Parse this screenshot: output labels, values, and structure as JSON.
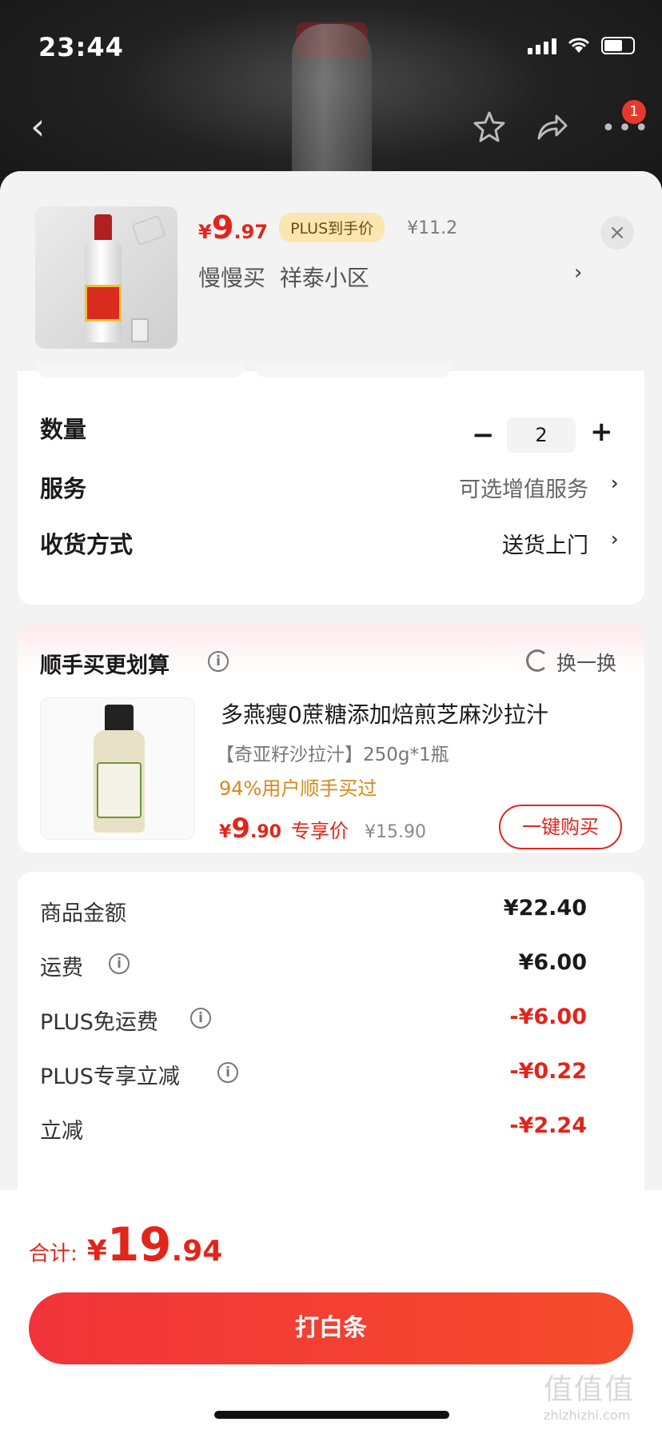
{
  "status_bar": {
    "time": "23:44"
  },
  "nav": {
    "badge": "1"
  },
  "product": {
    "price_yen": "¥",
    "price_int": "9",
    "price_dec": ".97",
    "plus_tag": "PLUS到手价",
    "orig_price": "¥11.2",
    "address": "慢慢买  祥泰小区"
  },
  "options": {
    "qty_label": "数量",
    "qty_value": "2",
    "service_label": "服务",
    "service_value": "可选增值服务",
    "delivery_label": "收货方式",
    "delivery_value": "送货上门"
  },
  "upsell": {
    "title": "顺手买更划算",
    "swap": "换一换",
    "name": "多燕瘦0蔗糖添加焙煎芝麻沙拉汁",
    "spec": "【奇亚籽沙拉汁】250g*1瓶",
    "hint": "94%用户顺手买过",
    "price_yen": "¥",
    "price_int": "9",
    "price_dec": ".90",
    "price_tag": "专享价",
    "orig_price": "¥15.90",
    "buy_button": "一键购买"
  },
  "costs": [
    {
      "label": "商品金额",
      "value": "¥22.40",
      "info": false,
      "red": false
    },
    {
      "label": "运费",
      "value": "¥6.00",
      "info": true,
      "red": false
    },
    {
      "label": "PLUS免运费",
      "value": "-¥6.00",
      "info": true,
      "red": true
    },
    {
      "label": "PLUS专享立减",
      "value": "-¥0.22",
      "info": true,
      "red": true
    },
    {
      "label": "立减",
      "value": "-¥2.24",
      "info": false,
      "red": true
    }
  ],
  "footer": {
    "total_label": "合计:",
    "total_yen": "¥",
    "total_int": "19",
    "total_dec": ".94",
    "pay_button": "打白条"
  },
  "watermark": {
    "line1": "值值值",
    "line2": "zhizhizhi.com"
  },
  "colors": {
    "accent": "#e1251b",
    "plus_tag_bg": "#fbe6b0",
    "hint": "#d48a1e"
  }
}
